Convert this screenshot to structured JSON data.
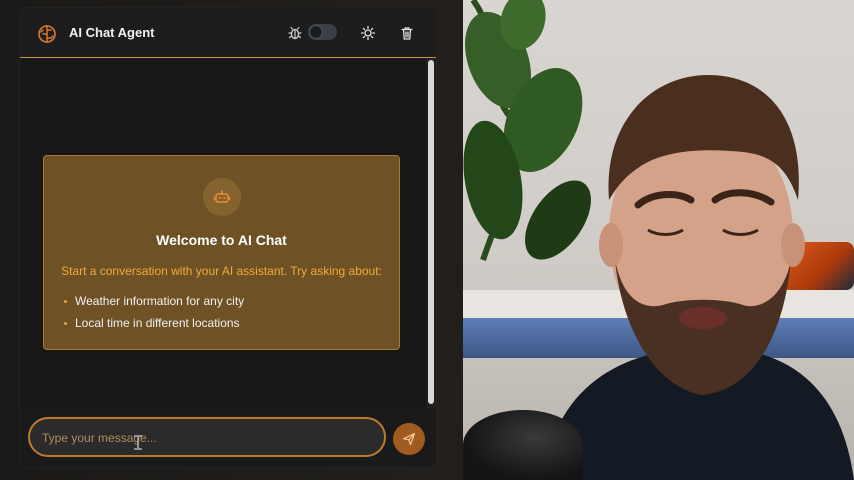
{
  "app": {
    "title": "AI Chat Agent",
    "accent_color": "#c9963e",
    "icons": {
      "logo": "brain-icon",
      "debug": "bug-icon",
      "theme": "sun-icon",
      "clear": "trash-icon",
      "bot": "robot-icon",
      "send": "send-icon"
    },
    "debug_toggle": {
      "on": false
    }
  },
  "welcome": {
    "title": "Welcome to AI Chat",
    "subtitle": "Start a conversation with your AI assistant. Try asking about:",
    "tips": [
      "Weather information for any city",
      "Local time in different locations"
    ]
  },
  "composer": {
    "placeholder": "Type your message...",
    "value": ""
  }
}
